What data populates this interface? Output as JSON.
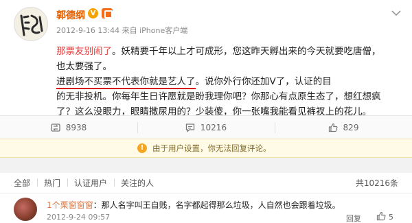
{
  "post": {
    "username": "郭德纲",
    "verified_badge": "V",
    "timestamp": "2012-9-16 13:44 来自 iPhone客户端",
    "lines": [
      {
        "hl": "那票友别闹了",
        "rest": "。妖精要千年以上才可成形，您这昨天孵出来的今天就要吃唐僧，"
      },
      {
        "text": "也太要强了。"
      },
      {
        "pre": "",
        "ul": "进剧场不买票不代表你就是艺人了",
        "rest": "。说你外行你还加V了，认证的目"
      },
      {
        "text": "的无非投机。你每年生日许愿就是盼我理你吧？你那心有点原生态了，想红想疯"
      },
      {
        "pre": "了？这么没眼力，眼睛撒尿用的？",
        "ul": "少装傻，你一张嘴我能看见裤衩上的花儿",
        "rest": "。"
      }
    ],
    "line2_rest": "进剧场不买票不代表你就是艺人了"
  },
  "actions": {
    "repost_count": "8938",
    "comment_count": "10216",
    "like_count": "829"
  },
  "notice": {
    "text": "由于用户设置，你无法回复评论。"
  },
  "comment_filter": {
    "tabs": [
      "全部",
      "热门",
      "认证用户",
      "关注的人"
    ],
    "total": "共10216条"
  },
  "comment": {
    "user": "1个栗窗窗窗",
    "text": "：那人名字叫王自贱，名字都起得那么垃圾，人自然也会跟着垃圾。",
    "time": "2012-9-24 09:57",
    "reply_label": "回复",
    "like_count": "5"
  },
  "icons": {
    "avatar": "calligraphy-avatar",
    "more": "chevron-down-icon",
    "repost": "repost-icon",
    "comment": "comment-icon",
    "like": "thumbs-up-icon",
    "warning": "warning-icon"
  },
  "colors": {
    "username": "#e35f00",
    "highlight": "#e53b3b",
    "underline": "#d71818",
    "notice_bg": "#fffbe6"
  }
}
